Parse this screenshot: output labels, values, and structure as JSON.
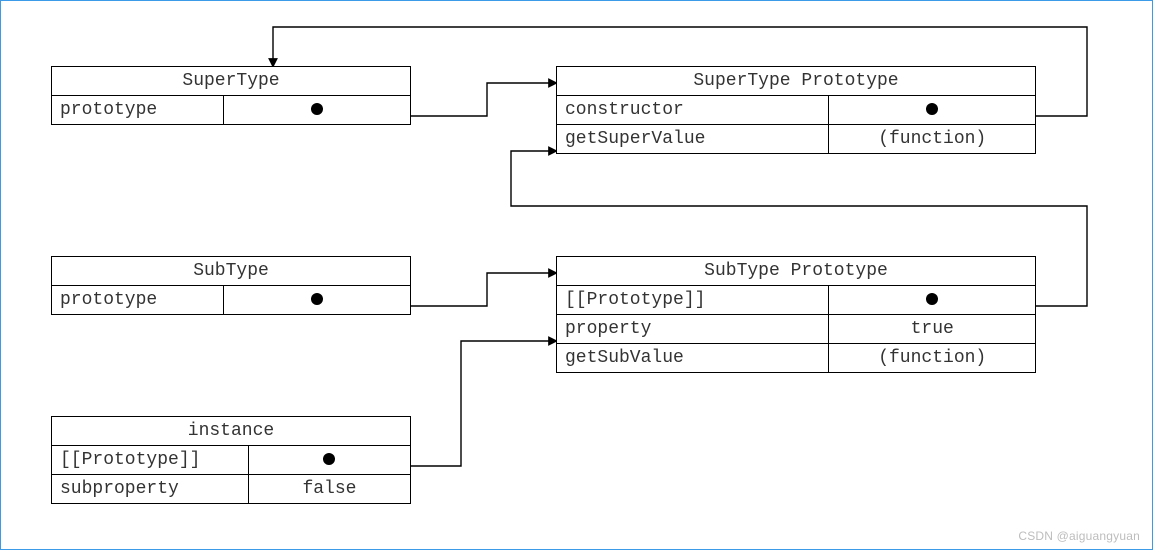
{
  "supertype": {
    "title": "SuperType",
    "rows": [
      {
        "label": "prototype",
        "value": "•"
      }
    ]
  },
  "supertype_proto": {
    "title": "SuperType Prototype",
    "rows": [
      {
        "label": "constructor",
        "value": "•"
      },
      {
        "label": "getSuperValue",
        "value": "(function)"
      }
    ]
  },
  "subtype": {
    "title": "SubType",
    "rows": [
      {
        "label": "prototype",
        "value": "•"
      }
    ]
  },
  "subtype_proto": {
    "title": "SubType Prototype",
    "rows": [
      {
        "label": "[[Prototype]]",
        "value": "•"
      },
      {
        "label": "property",
        "value": "true"
      },
      {
        "label": "getSubValue",
        "value": "(function)"
      }
    ]
  },
  "instance": {
    "title": "instance",
    "rows": [
      {
        "label": "[[Prototype]]",
        "value": "•"
      },
      {
        "label": "subproperty",
        "value": "false"
      }
    ]
  },
  "watermark": "CSDN @aiguangyuan"
}
